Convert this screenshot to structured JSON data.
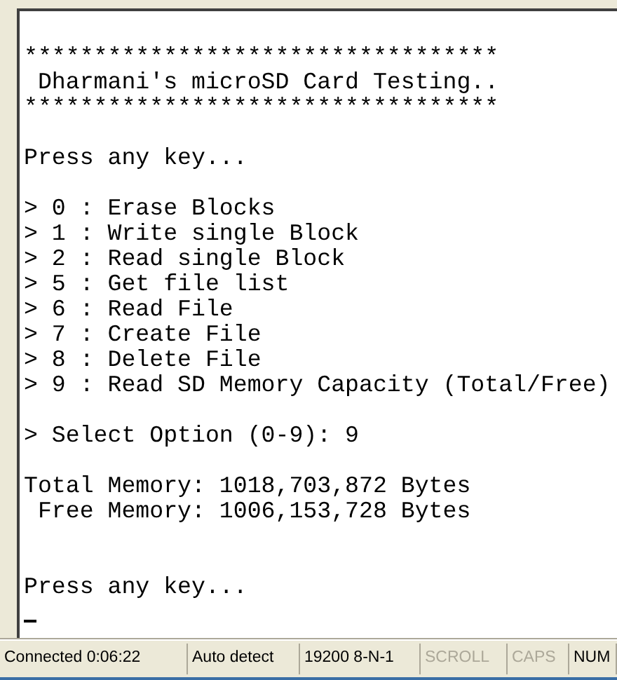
{
  "terminal": {
    "lines": [
      {
        "kind": "text",
        "text": "**********************************"
      },
      {
        "kind": "text",
        "text": " Dharmani's microSD Card Testing.."
      },
      {
        "kind": "text",
        "text": "**********************************"
      },
      {
        "kind": "blank"
      },
      {
        "kind": "text",
        "text": "Press any key..."
      },
      {
        "kind": "blank"
      },
      {
        "kind": "text",
        "text": "> 0 : Erase Blocks"
      },
      {
        "kind": "text",
        "text": "> 1 : Write single Block"
      },
      {
        "kind": "text",
        "text": "> 2 : Read single Block"
      },
      {
        "kind": "text",
        "text": "> 5 : Get file list"
      },
      {
        "kind": "text",
        "text": "> 6 : Read File"
      },
      {
        "kind": "text",
        "text": "> 7 : Create File"
      },
      {
        "kind": "text",
        "text": "> 8 : Delete File"
      },
      {
        "kind": "text",
        "text": "> 9 : Read SD Memory Capacity (Total/Free)"
      },
      {
        "kind": "blank"
      },
      {
        "kind": "text",
        "text": "> Select Option (0-9): 9"
      },
      {
        "kind": "blank"
      },
      {
        "kind": "text",
        "text": "Total Memory: 1018,703,872 Bytes"
      },
      {
        "kind": "text",
        "text": " Free Memory: 1006,153,728 Bytes"
      },
      {
        "kind": "blank"
      },
      {
        "kind": "blank"
      },
      {
        "kind": "text",
        "text": "Press any key..."
      },
      {
        "kind": "cursor"
      }
    ]
  },
  "status_bar": [
    {
      "text": "Connected 0:06:22",
      "disabled": false
    },
    {
      "text": "Auto detect",
      "disabled": false
    },
    {
      "text": "19200 8-N-1",
      "disabled": false
    },
    {
      "text": "SCROLL",
      "disabled": true
    },
    {
      "text": "CAPS",
      "disabled": true
    },
    {
      "text": "NUM",
      "disabled": false
    }
  ]
}
